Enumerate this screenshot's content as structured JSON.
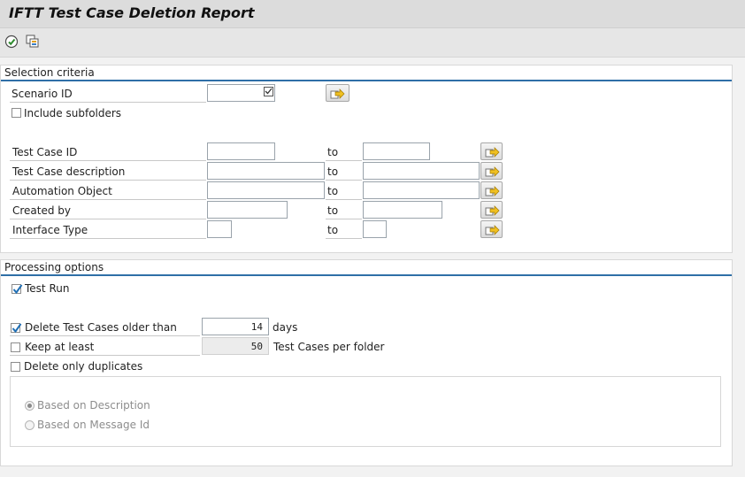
{
  "header": {
    "title": "IFTT Test Case Deletion Report"
  },
  "toolbar": {
    "execute_icon": "execute-icon",
    "variant_icon": "get-variant-icon"
  },
  "selection": {
    "section_title": "Selection criteria",
    "scenario_label": "Scenario ID",
    "scenario_value": "",
    "include_subfolders_label": "Include subfolders",
    "include_subfolders_checked": false,
    "to_label": "to",
    "rows": [
      {
        "label": "Test Case ID",
        "from": "",
        "to": ""
      },
      {
        "label": "Test Case description",
        "from": "",
        "to": ""
      },
      {
        "label": "Automation Object",
        "from": "",
        "to": ""
      },
      {
        "label": "Created by",
        "from": "",
        "to": ""
      },
      {
        "label": "Interface Type",
        "from": "",
        "to": ""
      }
    ],
    "multiple_selection_icon": "multiple-selection-arrow-icon"
  },
  "processing": {
    "section_title": "Processing options",
    "test_run_label": "Test Run",
    "test_run_checked": true,
    "delete_older_label": "Delete Test Cases older than",
    "delete_older_checked": true,
    "delete_older_value": "14",
    "delete_older_unit": "days",
    "keep_at_least_label": "Keep at least",
    "keep_at_least_checked": false,
    "keep_at_least_value": "50",
    "keep_at_least_unit": "Test Cases per folder",
    "delete_duplicates_label": "Delete only duplicates",
    "delete_duplicates_checked": false,
    "radio_description_label": "Based on Description",
    "radio_description_selected": true,
    "radio_message_label": "Based on Message Id",
    "radio_message_selected": false
  },
  "colors": {
    "section_line": "#2f6fa7",
    "arrow_yellow": "#f0c020",
    "check_blue": "#1f6fb5"
  }
}
